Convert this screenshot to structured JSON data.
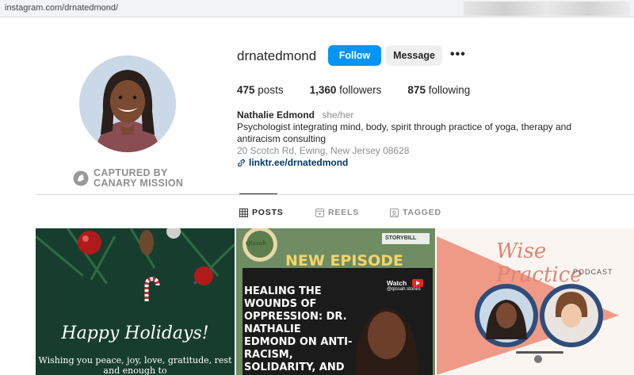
{
  "browser": {
    "url": "instagram.com/drnatedmond/"
  },
  "profile": {
    "username": "drnatedmond",
    "follow_label": "Follow",
    "message_label": "Message",
    "more_label": "•••",
    "stats": {
      "posts_count": "475",
      "posts_label": "posts",
      "followers_count": "1,360",
      "followers_label": "followers",
      "following_count": "875",
      "following_label": "following"
    },
    "bio": {
      "name": "Nathalie Edmond",
      "pronouns": "she/her",
      "description": "Psychologist integrating mind, body, spirit through practice of yoga, therapy and antiracism consulting",
      "address": "20 Scotch Rd, Ewing, New Jersey 08628",
      "link": "linktr.ee/drnatedmond"
    }
  },
  "watermark": {
    "line1": "CAPTURED BY",
    "line2": "CANARY MISSION"
  },
  "tabs": [
    {
      "label": "POSTS",
      "icon": "grid-icon",
      "active": true
    },
    {
      "label": "REELS",
      "icon": "reels-icon",
      "active": false
    },
    {
      "label": "TAGGED",
      "icon": "tagged-icon",
      "active": false
    }
  ],
  "posts": [
    {
      "title": "Happy Holidays!",
      "text": "Wishing you peace, joy, love, gratitude, rest and enough to"
    },
    {
      "badge": "STORYBILL",
      "logo": "Qissah",
      "heading": "NEW EPISODE",
      "watch": "Watch",
      "handle": "@qissah.stories",
      "body": "HEALING THE WOUNDS OF OPPRESSION: DR. NATHALIE EDMOND ON ANTI-RACISM, SOLIDARITY, AND MENTAL HEALTH"
    },
    {
      "title": "Wise Practice",
      "subtitle": "PODCAST"
    }
  ],
  "colors": {
    "accent": "#0095f6",
    "link": "#00376b",
    "muted": "#8e8e8e"
  }
}
